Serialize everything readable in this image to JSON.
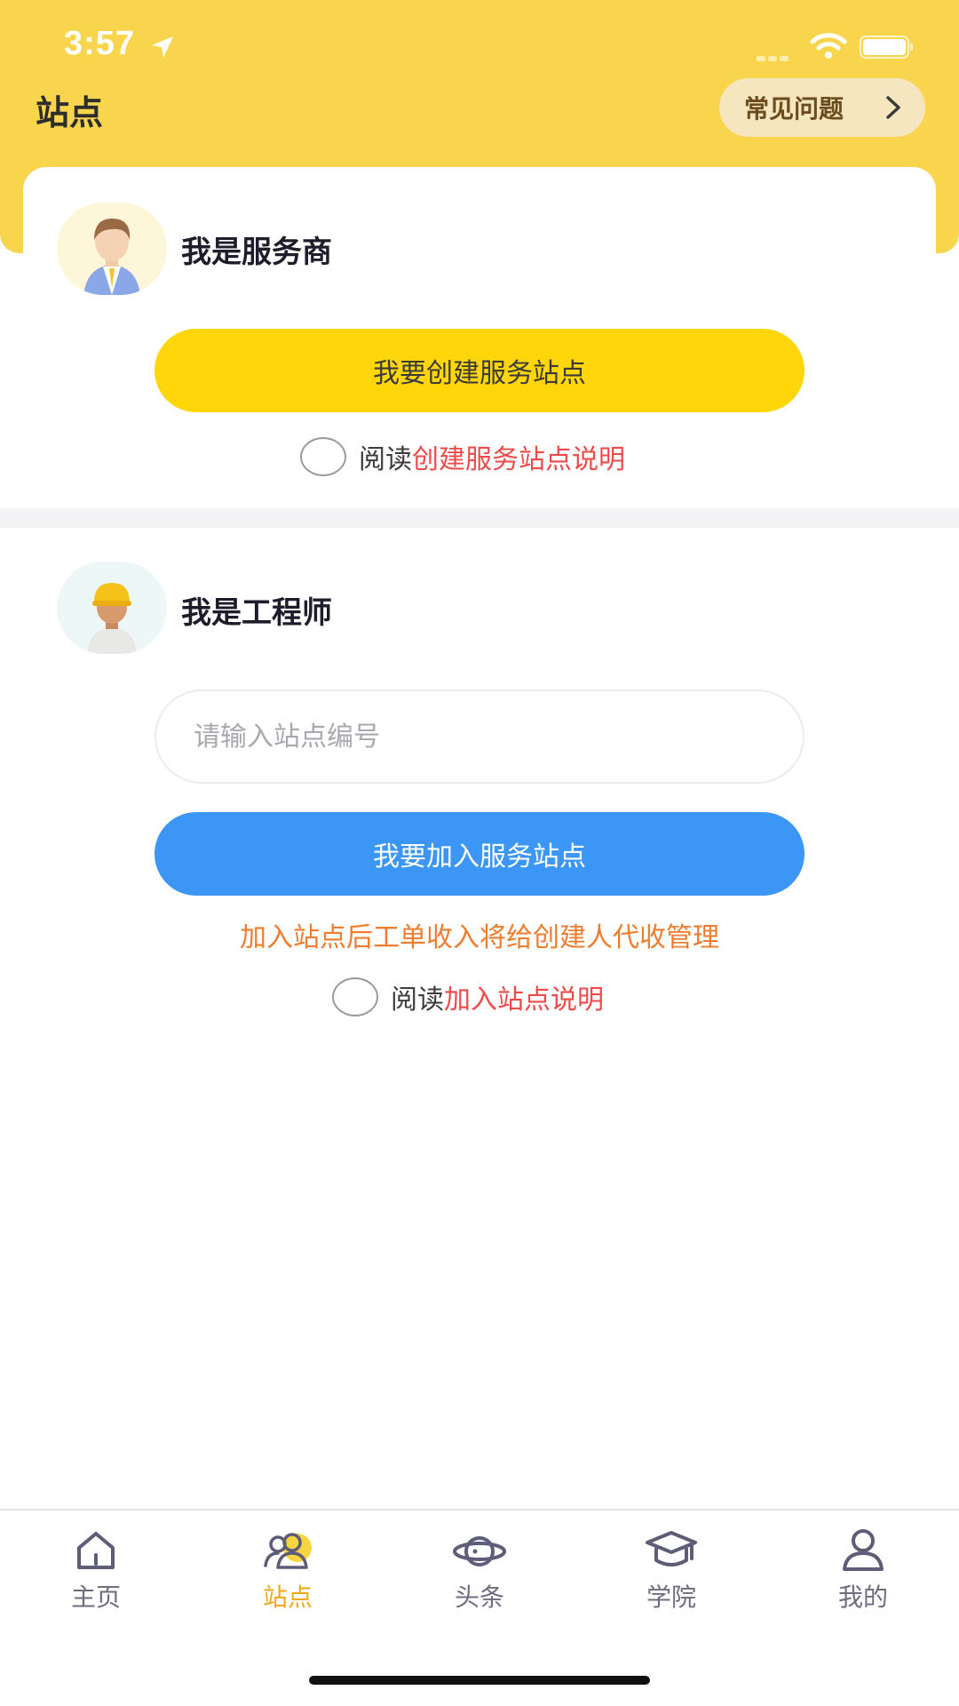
{
  "status_bar": {
    "time": "3:57"
  },
  "header": {
    "title": "站点",
    "faq_label": "常见问题"
  },
  "provider": {
    "title": "我是服务商",
    "button_label": "我要创建服务站点",
    "read_label": "阅读",
    "read_link": "创建服务站点说明"
  },
  "engineer": {
    "title": "我是工程师",
    "input_placeholder": "请输入站点编号",
    "input_value": "",
    "button_label": "我要加入服务站点",
    "notice": "加入站点后工单收入将给创建人代收管理",
    "read_label": "阅读",
    "read_link": "加入站点说明"
  },
  "tabbar": {
    "items": [
      {
        "label": "主页",
        "icon": "home-icon",
        "active": false
      },
      {
        "label": "站点",
        "icon": "site-icon",
        "active": true
      },
      {
        "label": "头条",
        "icon": "planet-icon",
        "active": false
      },
      {
        "label": "学院",
        "icon": "graduation-cap-icon",
        "active": false
      },
      {
        "label": "我的",
        "icon": "user-icon",
        "active": false
      }
    ]
  },
  "colors": {
    "header_yellow": "#f8d54d",
    "primary_yellow": "#ffd60a",
    "primary_blue": "#3b96f5",
    "link_red": "#ee4a4a",
    "notice_orange": "#f07c2e",
    "tab_active": "#f3a81a"
  }
}
